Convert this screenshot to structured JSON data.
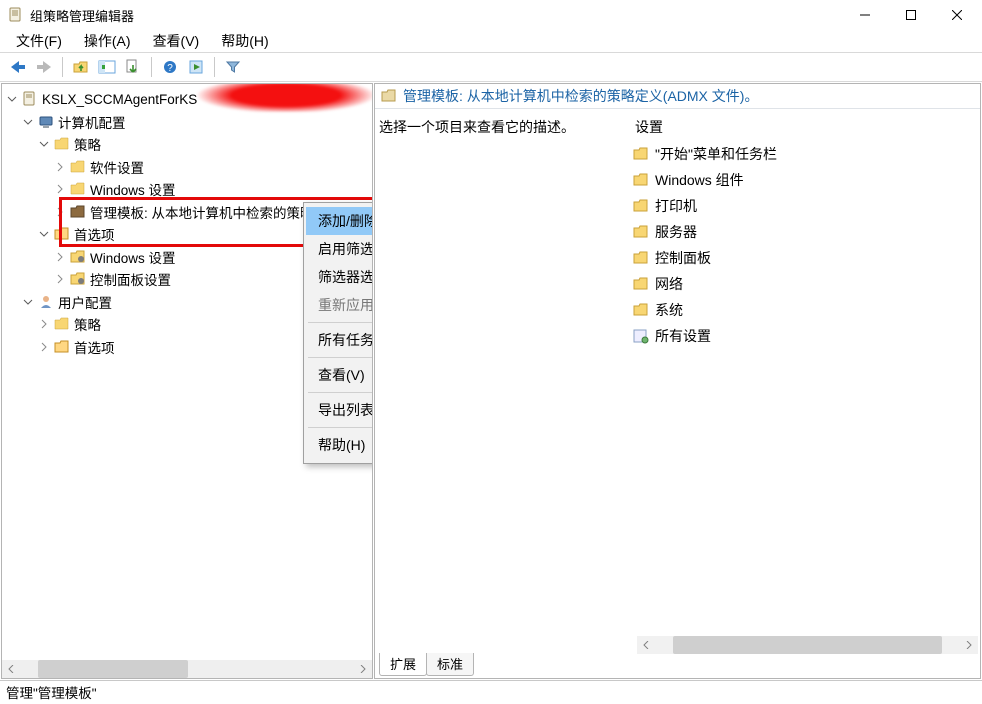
{
  "window": {
    "title": "组策略管理编辑器"
  },
  "menu": {
    "file": "文件(F)",
    "action": "操作(A)",
    "view": "查看(V)",
    "help": "帮助(H)"
  },
  "tree": {
    "root": "KSLX_SCCMAgentForKS",
    "computer": "计算机配置",
    "policy": "策略",
    "software": "软件设置",
    "windows": "Windows 设置",
    "admin_templates": "管理模板: 从本地计算机中检索的策略定",
    "preferences": "首选项",
    "pref_windows": "Windows 设置",
    "pref_control": "控制面板设置",
    "user": "用户配置",
    "user_policy": "策略",
    "user_pref": "首选项"
  },
  "context_menu": {
    "add_remove": "添加/删除模板(A)...",
    "filter_on": "启用筛选器(F)",
    "filter_options": "筛选器选项(O)...",
    "reapply": "重新应用筛选器(E)",
    "all_tasks": "所有任务(K)",
    "view": "查看(V)",
    "export_list": "导出列表(L)...",
    "help": "帮助(H)"
  },
  "right": {
    "header": "管理模板: 从本地计算机中检索的策略定义(ADMX 文件)。",
    "description": "选择一个项目来查看它的描述。",
    "settings_label": "设置",
    "items": [
      "\"开始\"菜单和任务栏",
      "Windows 组件",
      "打印机",
      "服务器",
      "控制面板",
      "网络",
      "系统",
      "所有设置"
    ],
    "tabs": {
      "extended": "扩展",
      "standard": "标准"
    }
  },
  "status": "管理\"管理模板\""
}
